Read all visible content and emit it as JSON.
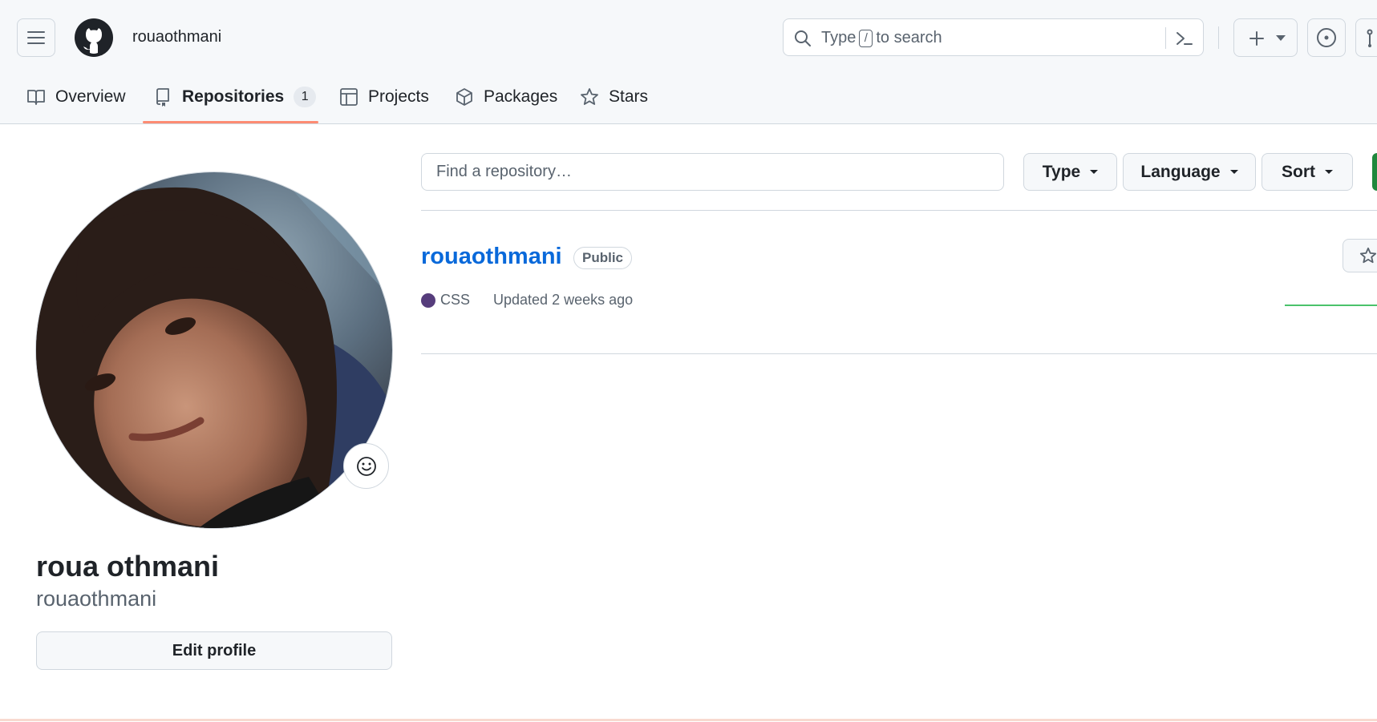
{
  "header": {
    "username": "rouaothmani",
    "search": {
      "before_key": "Type",
      "key": "/",
      "after_key": "to search"
    }
  },
  "tabs": [
    {
      "label": "Overview",
      "icon": "book-icon"
    },
    {
      "label": "Repositories",
      "icon": "repo-icon",
      "count": "1",
      "active": true
    },
    {
      "label": "Projects",
      "icon": "table-icon"
    },
    {
      "label": "Packages",
      "icon": "package-icon"
    },
    {
      "label": "Stars",
      "icon": "star-icon"
    }
  ],
  "profile": {
    "fullname": "roua othmani",
    "login": "rouaothmani",
    "edit_label": "Edit profile"
  },
  "filters": {
    "placeholder": "Find a repository…",
    "type_label": "Type",
    "language_label": "Language",
    "sort_label": "Sort"
  },
  "repositories": [
    {
      "name": "rouaothmani",
      "visibility": "Public",
      "language": "CSS",
      "language_color": "#563d7c",
      "updated": "Updated 2 weeks ago"
    }
  ],
  "colors": {
    "accent": "#0969da",
    "tab_underline": "#fd8c73",
    "new_button": "#1f883d"
  }
}
